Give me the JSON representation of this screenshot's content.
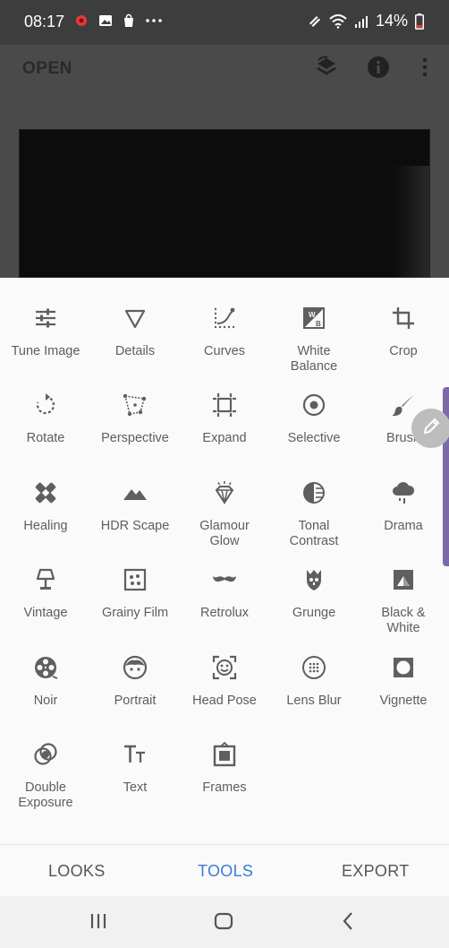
{
  "status_bar": {
    "time": "08:17",
    "battery": "14%"
  },
  "app_bar": {
    "open_label": "OPEN"
  },
  "tools": [
    {
      "id": "tune-image",
      "label": "Tune Image",
      "icon": "sliders-icon"
    },
    {
      "id": "details",
      "label": "Details",
      "icon": "triangle-down-icon"
    },
    {
      "id": "curves",
      "label": "Curves",
      "icon": "curve-icon"
    },
    {
      "id": "white-balance",
      "label": "White\nBalance",
      "icon": "white-balance-icon"
    },
    {
      "id": "crop",
      "label": "Crop",
      "icon": "crop-icon"
    },
    {
      "id": "rotate",
      "label": "Rotate",
      "icon": "rotate-icon"
    },
    {
      "id": "perspective",
      "label": "Perspective",
      "icon": "perspective-icon"
    },
    {
      "id": "expand",
      "label": "Expand",
      "icon": "expand-icon"
    },
    {
      "id": "selective",
      "label": "Selective",
      "icon": "selective-icon"
    },
    {
      "id": "brush",
      "label": "Brush",
      "icon": "brush-icon"
    },
    {
      "id": "healing",
      "label": "Healing",
      "icon": "bandage-icon"
    },
    {
      "id": "hdr-scape",
      "label": "HDR Scape",
      "icon": "mountains-icon"
    },
    {
      "id": "glamour-glow",
      "label": "Glamour\nGlow",
      "icon": "diamond-icon"
    },
    {
      "id": "tonal-contrast",
      "label": "Tonal\nContrast",
      "icon": "tonal-contrast-icon"
    },
    {
      "id": "drama",
      "label": "Drama",
      "icon": "cloud-rain-icon"
    },
    {
      "id": "vintage",
      "label": "Vintage",
      "icon": "lamp-icon"
    },
    {
      "id": "grainy-film",
      "label": "Grainy Film",
      "icon": "dice-icon"
    },
    {
      "id": "retrolux",
      "label": "Retrolux",
      "icon": "mustache-icon"
    },
    {
      "id": "grunge",
      "label": "Grunge",
      "icon": "grunge-icon"
    },
    {
      "id": "black-white",
      "label": "Black &\nWhite",
      "icon": "black-white-icon"
    },
    {
      "id": "noir",
      "label": "Noir",
      "icon": "film-reel-icon"
    },
    {
      "id": "portrait",
      "label": "Portrait",
      "icon": "face-icon"
    },
    {
      "id": "head-pose",
      "label": "Head Pose",
      "icon": "face-frame-icon"
    },
    {
      "id": "lens-blur",
      "label": "Lens Blur",
      "icon": "lens-blur-icon"
    },
    {
      "id": "vignette",
      "label": "Vignette",
      "icon": "vignette-icon"
    },
    {
      "id": "double-exposure",
      "label": "Double\nExposure",
      "icon": "double-exposure-icon"
    },
    {
      "id": "text",
      "label": "Text",
      "icon": "text-icon"
    },
    {
      "id": "frames",
      "label": "Frames",
      "icon": "frame-icon"
    }
  ],
  "bottom_nav": {
    "looks": "LOOKS",
    "tools": "TOOLS",
    "export": "EXPORT",
    "active": "TOOLS",
    "active_color": "#3a7bd5"
  }
}
